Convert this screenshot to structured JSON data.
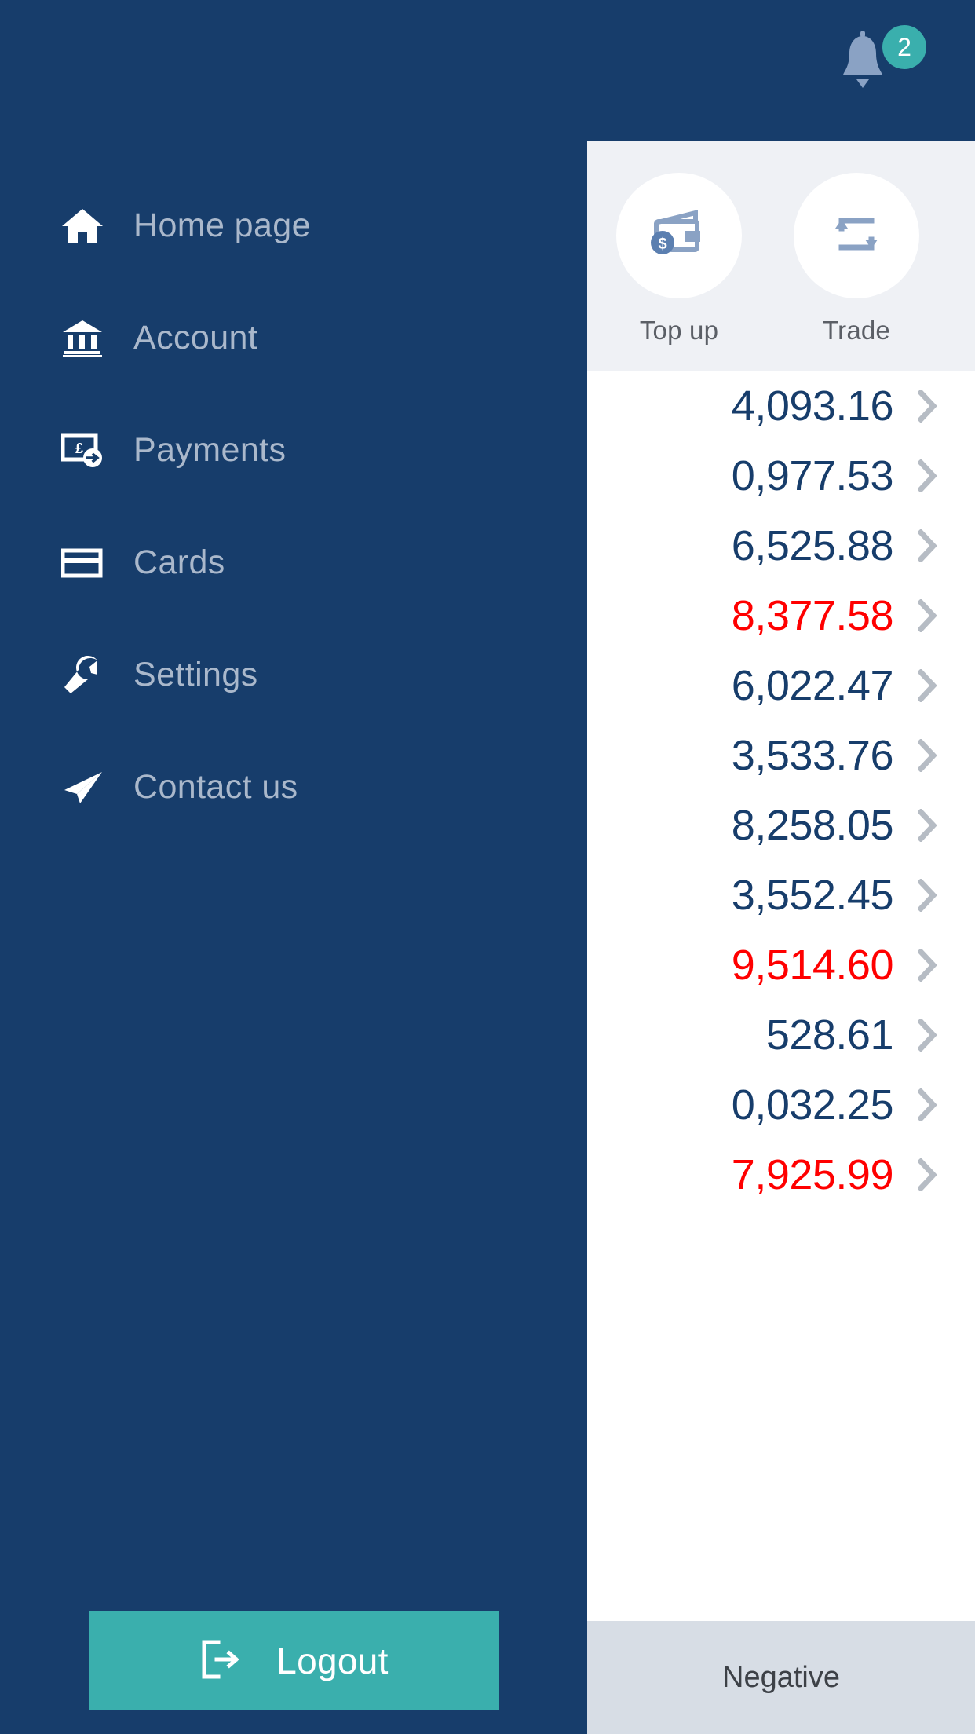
{
  "topbar": {
    "menu_icon": "hamburger-menu-icon",
    "notifications_icon": "bell-icon",
    "notification_count": "2",
    "badge_color": "#3aafad"
  },
  "sidebar": {
    "background_color": "#173d6b",
    "items": [
      {
        "label": "Home page",
        "icon": "home-icon"
      },
      {
        "label": "Account",
        "icon": "bank-icon"
      },
      {
        "label": "Payments",
        "icon": "banknote-pound-icon"
      },
      {
        "label": "Cards",
        "icon": "credit-card-icon"
      },
      {
        "label": "Settings",
        "icon": "wrench-icon"
      },
      {
        "label": "Contact us",
        "icon": "paper-plane-icon"
      }
    ],
    "logout": {
      "label": "Logout",
      "icon": "sign-out-icon",
      "background_color": "#3aafad"
    }
  },
  "content": {
    "quick_actions": [
      {
        "label": "Top up",
        "icon": "wallet-dollar-icon"
      },
      {
        "label": "Trade",
        "icon": "exchange-arrows-icon"
      }
    ],
    "balances": [
      {
        "amount": "4,093.16",
        "negative": false
      },
      {
        "amount": "0,977.53",
        "negative": false
      },
      {
        "amount": "6,525.88",
        "negative": false
      },
      {
        "amount": "8,377.58",
        "negative": true
      },
      {
        "amount": "6,022.47",
        "negative": false
      },
      {
        "amount": "3,533.76",
        "negative": false
      },
      {
        "amount": "8,258.05",
        "negative": false
      },
      {
        "amount": "3,552.45",
        "negative": false
      },
      {
        "amount": "9,514.60",
        "negative": true
      },
      {
        "amount": "528.61",
        "negative": false
      },
      {
        "amount": "0,032.25",
        "negative": false
      },
      {
        "amount": "7,925.99",
        "negative": true
      }
    ],
    "chevron_icon": "chevron-right-icon",
    "footer_label": "Negative",
    "positive_color": "#173d6b",
    "negative_color": "#ff0000"
  }
}
